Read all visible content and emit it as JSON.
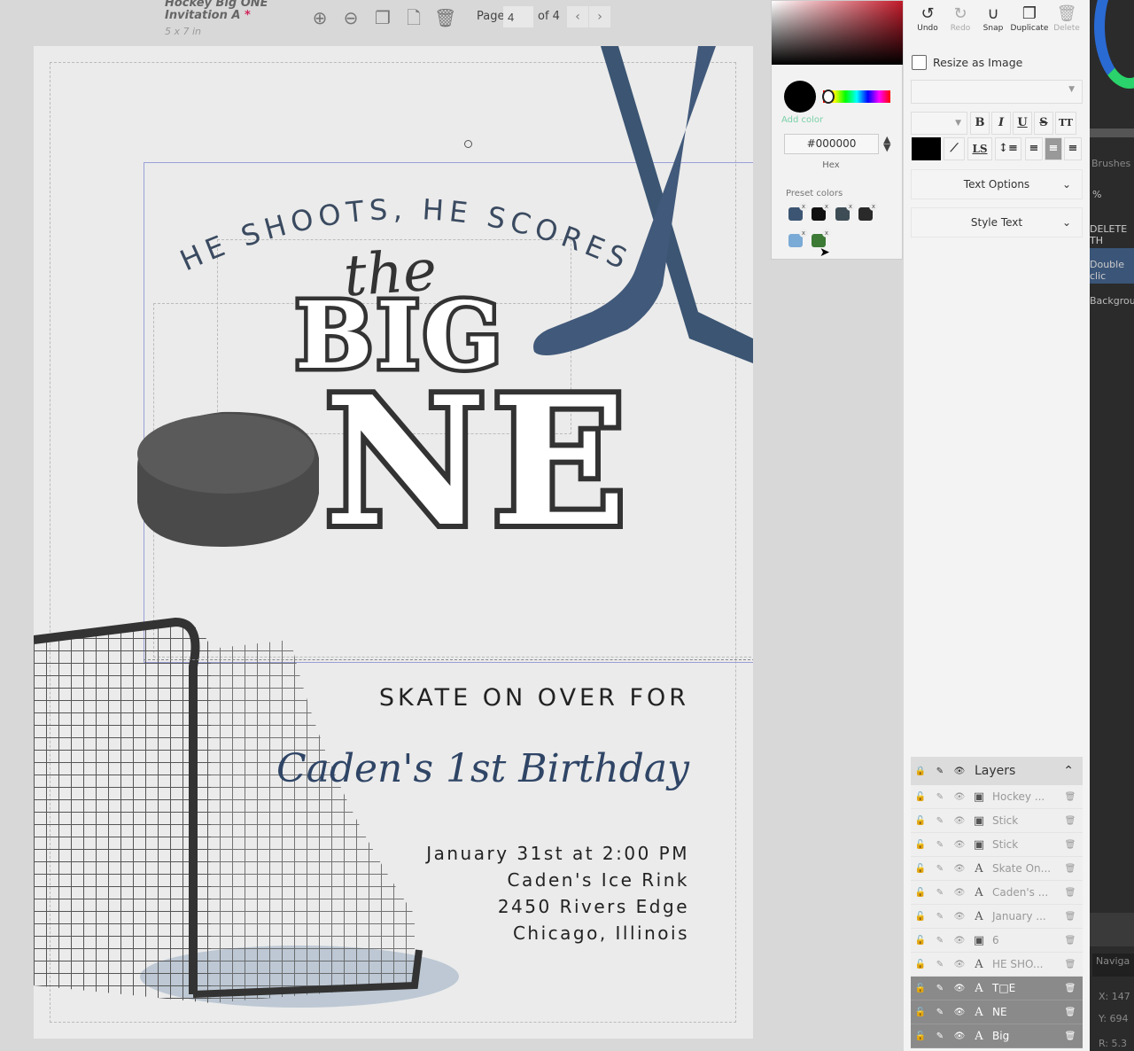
{
  "topbar": {
    "doc_title_line1": "Hockey Big ONE",
    "doc_title_line2": "Invitation A",
    "unsaved_mark": "*",
    "doc_size": "5 x 7 in",
    "icons": [
      "zoom-in-icon",
      "zoom-out-icon",
      "copy-page-icon",
      "add-page-icon",
      "trash-icon"
    ],
    "page_label": "Page",
    "page_value": "4",
    "page_of": "of 4",
    "prev": "‹",
    "next": "›"
  },
  "canvas": {
    "arc_text": "HE SHOOTS, HE SCORES",
    "the": "the",
    "big": "BIG",
    "ne": "NE",
    "skate": "SKATE ON OVER  FOR",
    "caden": "Caden's 1st Birthday",
    "details": [
      "January 31st at 2:00 PM",
      "Caden's Ice Rink",
      "2450 Rivers Edge",
      "Chicago, Illinois"
    ]
  },
  "color_picker": {
    "add_color": "Add color",
    "hex_value": "#000000",
    "hex_label": "Hex",
    "preset_label": "Preset colors",
    "presets": [
      "#3b5573",
      "#111111",
      "#3e4d55",
      "#2a2a2a",
      "#7aaad6",
      "#3c7a35"
    ],
    "remove_mark": "x"
  },
  "toolbar": {
    "undo": "Undo",
    "redo": "Redo",
    "snap": "Snap",
    "duplicate": "Duplicate",
    "delete": "Delete",
    "resize_as_image": "Resize as Image",
    "text_color": "#000000",
    "bold": "B",
    "italic": "I",
    "underline": "U",
    "strike": "S",
    "caps": "TT",
    "letter_spacing": "LS",
    "text_options": "Text Options",
    "style_text": "Style Text"
  },
  "layers": {
    "title": "Layers",
    "items": [
      {
        "name": "Hockey ...",
        "type": "image",
        "selected": false
      },
      {
        "name": "Stick",
        "type": "image",
        "selected": false
      },
      {
        "name": "Stick",
        "type": "image",
        "selected": false
      },
      {
        "name": "Skate On...",
        "type": "text",
        "selected": false
      },
      {
        "name": "Caden's ...",
        "type": "text",
        "selected": false
      },
      {
        "name": "January ...",
        "type": "text",
        "selected": false
      },
      {
        "name": "6",
        "type": "image",
        "selected": false
      },
      {
        "name": "HE SHO...",
        "type": "text",
        "selected": false
      },
      {
        "name": "T□E",
        "type": "text",
        "selected": true
      },
      {
        "name": "NE",
        "type": "text",
        "selected": true
      },
      {
        "name": "Big",
        "type": "text",
        "selected": true
      }
    ]
  },
  "side_dark": {
    "brushes": "Brushes",
    "percent": "%",
    "delete": "DELETE TH",
    "double_click": "Double clic",
    "background": "Backgroun",
    "navigator": "Naviga",
    "x": "X: 147",
    "y": "Y: 694",
    "r": "R: 5.3"
  }
}
